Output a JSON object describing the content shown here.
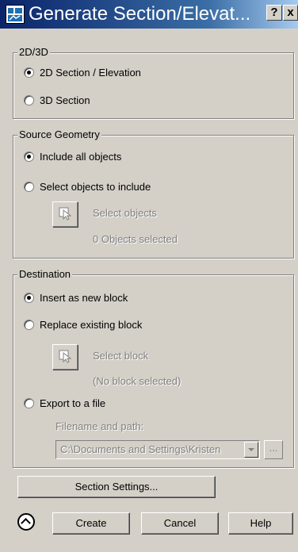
{
  "window": {
    "title": "Generate Section/Elevat...",
    "help_button": "?",
    "close_button": "x"
  },
  "group_2d3d": {
    "legend": "2D/3D",
    "options": [
      {
        "label": "2D Section / Elevation",
        "checked": true
      },
      {
        "label": "3D Section",
        "checked": false
      }
    ]
  },
  "source_geometry": {
    "legend": "Source Geometry",
    "options": [
      {
        "label": "Include all objects",
        "checked": true
      },
      {
        "label": "Select objects to include",
        "checked": false
      }
    ],
    "select_label": "Select objects",
    "selected_count_text": "0 Objects selected"
  },
  "destination": {
    "legend": "Destination",
    "options": [
      {
        "label": "Insert as new block",
        "checked": true
      },
      {
        "label": "Replace existing block",
        "checked": false
      },
      {
        "label": "Export to a file",
        "checked": false
      }
    ],
    "select_block_label": "Select block",
    "block_status_text": "(No block selected)",
    "filename_label": "Filename and path:",
    "filename_value": "C:\\Documents and Settings\\Kristen",
    "browse_button": "..."
  },
  "buttons": {
    "section_settings": "Section Settings...",
    "create": "Create",
    "cancel": "Cancel",
    "help": "Help"
  }
}
